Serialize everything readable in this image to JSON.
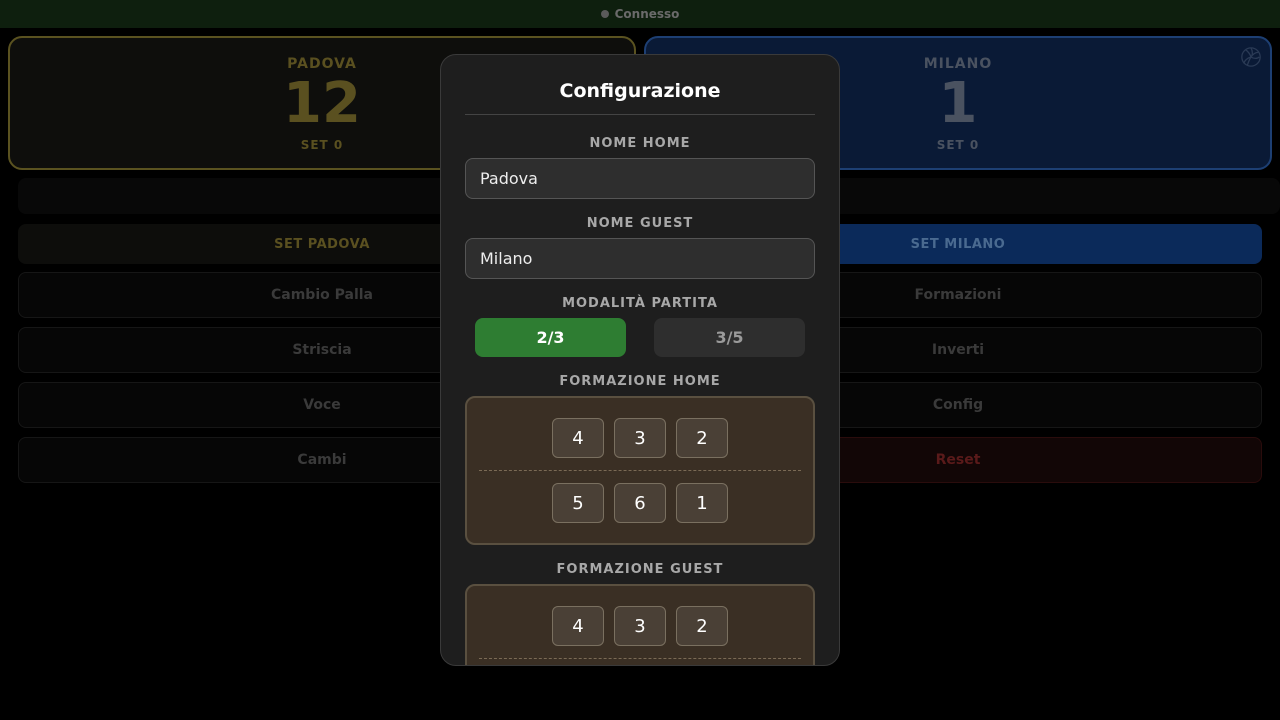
{
  "status": {
    "text": "Connesso"
  },
  "home": {
    "name": "PADOVA",
    "points": "12",
    "set": "SET 0",
    "set_button": "SET PADOVA"
  },
  "guest": {
    "name": "MILANO",
    "points": "1",
    "set": "SET 0",
    "set_button": "SET MILANO"
  },
  "controls": {
    "left": [
      "Cambio Palla",
      "Striscia",
      "Voce",
      "Cambi"
    ],
    "right": [
      "Formazioni",
      "Inverti",
      "Config",
      "Reset"
    ]
  },
  "modal": {
    "title": "Configurazione",
    "home_name_label": "NOME HOME",
    "home_name_value": "Padova",
    "guest_name_label": "NOME GUEST",
    "guest_name_value": "Milano",
    "mode_label": "MODALITÀ PARTITA",
    "modes": [
      "2/3",
      "3/5"
    ],
    "selected_mode": "2/3",
    "home_formation_label": "FORMAZIONE HOME",
    "home_formation": {
      "front": [
        "4",
        "3",
        "2"
      ],
      "back": [
        "5",
        "6",
        "1"
      ]
    },
    "guest_formation_label": "FORMAZIONE GUEST",
    "guest_formation": {
      "front": [
        "4",
        "3",
        "2"
      ]
    }
  },
  "colors": {
    "accent_green": "#2e7d32",
    "home_gold": "#5a5020",
    "guest_blue": "#0b2a5a",
    "reset_red": "#5a1a1a"
  },
  "icons": {
    "volleyball": "volleyball-icon",
    "status": "status-dot-icon"
  }
}
